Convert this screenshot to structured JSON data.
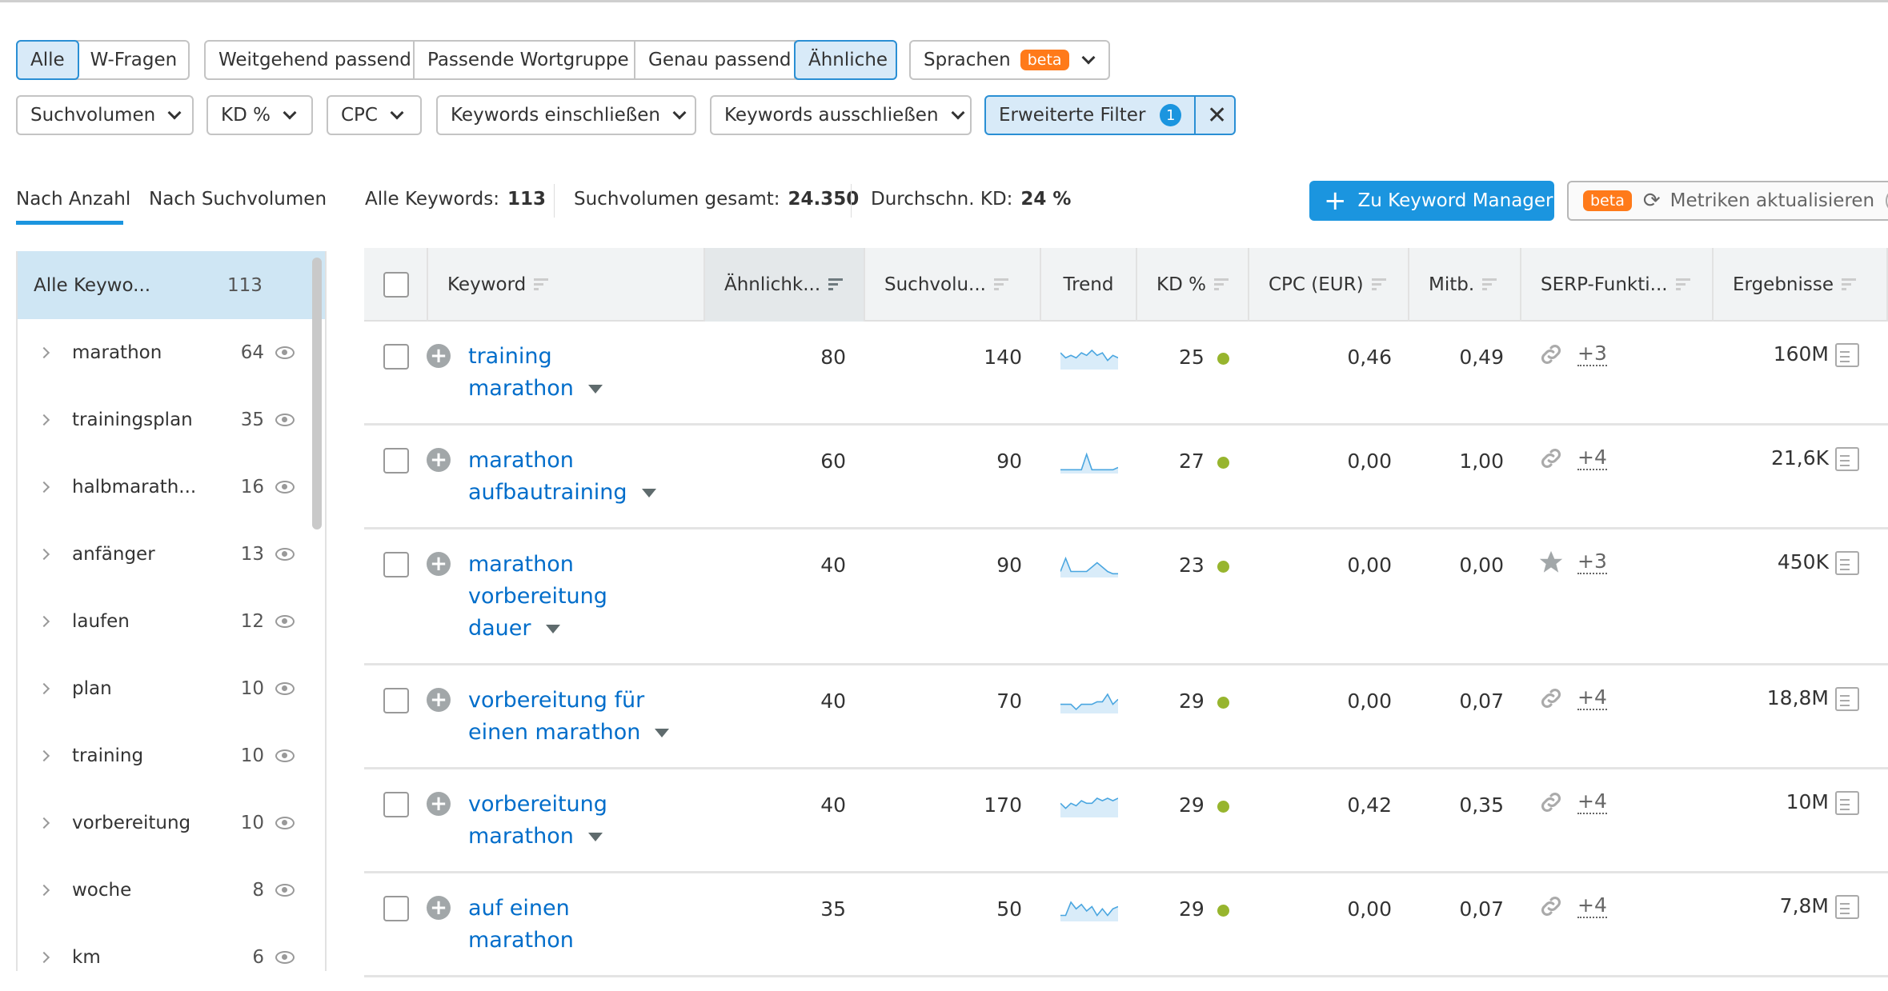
{
  "filters": {
    "row1_group1": [
      "Alle",
      "W-Fragen"
    ],
    "row1_group2": [
      "Weitgehend passend",
      "Passende Wortgruppe",
      "Genau passend",
      "Ähnliche"
    ],
    "languages": {
      "label": "Sprachen",
      "badge": "beta"
    },
    "row2": [
      "Suchvolumen",
      "KD %",
      "CPC",
      "Keywords einschließen",
      "Keywords ausschließen"
    ],
    "advanced": {
      "label": "Erweiterte Filter",
      "count": "1"
    }
  },
  "tabs": [
    "Nach Anzahl",
    "Nach Suchvolumen"
  ],
  "stats": {
    "all_keywords_label": "Alle Keywords:",
    "all_keywords": "113",
    "volume_label": "Suchvolumen gesamt:",
    "volume": "24.350",
    "kd_label": "Durchschn. KD:",
    "kd": "24 %"
  },
  "actions": {
    "keyword_manager": "Zu Keyword Manager",
    "metrics_badge": "beta",
    "metrics": "Metriken aktualisieren"
  },
  "sidebar": {
    "all": {
      "label": "Alle Keywo...",
      "count": "113"
    },
    "items": [
      {
        "label": "marathon",
        "count": "64"
      },
      {
        "label": "trainingsplan",
        "count": "35"
      },
      {
        "label": "halbmarath...",
        "count": "16"
      },
      {
        "label": "anfänger",
        "count": "13"
      },
      {
        "label": "laufen",
        "count": "12"
      },
      {
        "label": "plan",
        "count": "10"
      },
      {
        "label": "training",
        "count": "10"
      },
      {
        "label": "vorbereitung",
        "count": "10"
      },
      {
        "label": "woche",
        "count": "8"
      },
      {
        "label": "km",
        "count": "6"
      }
    ]
  },
  "table": {
    "headers": [
      "Keyword",
      "Ähnlichk...",
      "Suchvolu...",
      "Trend",
      "KD %",
      "CPC (EUR)",
      "Mitb.",
      "SERP-Funkti...",
      "Ergebnisse"
    ],
    "rows": [
      {
        "keyword": [
          "training",
          "marathon"
        ],
        "similarity": "80",
        "volume": "140",
        "trend": [
          6,
          4,
          5,
          4,
          6,
          5,
          7,
          5,
          6,
          3,
          5,
          4
        ],
        "kd": "25",
        "cpc": "0,46",
        "comp": "0,49",
        "serp_icon": "link",
        "serp_more": "+3",
        "results": "160M"
      },
      {
        "keyword": [
          "marathon",
          "aufbautraining"
        ],
        "similarity": "60",
        "volume": "90",
        "trend": [
          1,
          1,
          1,
          1,
          1,
          8,
          1,
          1,
          1,
          1,
          1,
          2
        ],
        "kd": "27",
        "cpc": "0,00",
        "comp": "1,00",
        "serp_icon": "link",
        "serp_more": "+4",
        "results": "21,6K"
      },
      {
        "keyword": [
          "marathon",
          "vorbereitung",
          "dauer"
        ],
        "similarity": "40",
        "volume": "90",
        "trend": [
          2,
          8,
          2,
          2,
          2,
          2,
          4,
          6,
          4,
          2,
          1,
          1
        ],
        "kd": "23",
        "cpc": "0,00",
        "comp": "0,00",
        "serp_icon": "star",
        "serp_more": "+3",
        "results": "450K"
      },
      {
        "keyword": [
          "vorbereitung für",
          "einen marathon"
        ],
        "similarity": "40",
        "volume": "70",
        "trend": [
          3,
          3,
          3,
          1,
          3,
          3,
          3,
          4,
          4,
          7,
          3,
          5
        ],
        "kd": "29",
        "cpc": "0,00",
        "comp": "0,07",
        "serp_icon": "link",
        "serp_more": "+4",
        "results": "18,8M"
      },
      {
        "keyword": [
          "vorbereitung",
          "marathon"
        ],
        "similarity": "40",
        "volume": "170",
        "trend": [
          5,
          3,
          5,
          4,
          6,
          5,
          5,
          7,
          6,
          7,
          6,
          7
        ],
        "kd": "29",
        "cpc": "0,42",
        "comp": "0,35",
        "serp_icon": "link",
        "serp_more": "+4",
        "results": "10M"
      },
      {
        "keyword": [
          "auf einen",
          "marathon"
        ],
        "similarity": "35",
        "volume": "50",
        "trend": [
          2,
          2,
          8,
          5,
          7,
          4,
          6,
          2,
          5,
          2,
          5,
          6
        ],
        "kd": "29",
        "cpc": "0,00",
        "comp": "0,07",
        "serp_icon": "link",
        "serp_more": "+4",
        "results": "7,8M"
      }
    ]
  },
  "colors": {
    "accent": "#1b95df",
    "link": "#006dca",
    "beta": "#ff7a1a",
    "kd_dot": "#97b52e",
    "selected_bg": "#d8eaf8"
  }
}
